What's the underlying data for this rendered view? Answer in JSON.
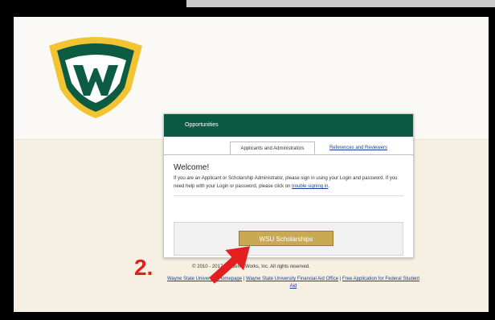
{
  "header": {
    "title": "Opportunities"
  },
  "tabs": [
    {
      "label": "Applicants and Administrators",
      "active": true
    },
    {
      "label": "References and Reviewers",
      "active": false
    }
  ],
  "welcome": {
    "heading": "Welcome!",
    "text_before": "If you are an Applicant or Scholarship Administrator, please sign in using your Login and password. If you need help with your Login or password, please click on ",
    "help_link": "trouble signing in",
    "text_after": "."
  },
  "sso_button": {
    "label": "WSU Scholarships"
  },
  "footer": {
    "copyright": "© 2010 - 2017 AcademicWorks, Inc. All rights reserved.",
    "links": [
      "Wayne State University Homepage",
      "Wayne State University Financial Aid Office",
      "Free Application for Federal Student Aid"
    ]
  },
  "annotation": {
    "step": "2."
  },
  "colors": {
    "header_green": "#0d5a44",
    "button_gold": "#c9a954",
    "arrow_red": "#e41f1f",
    "logo_green": "#0b5c43",
    "logo_gold": "#f2c432"
  }
}
